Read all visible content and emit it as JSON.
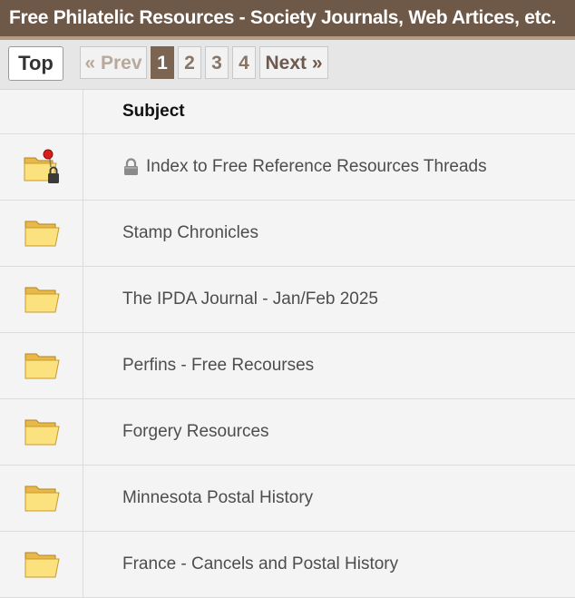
{
  "header": {
    "title": "Free Philatelic Resources - Society Journals, Web Artices, etc."
  },
  "pager": {
    "top_label": "Top",
    "prev_label": "« Prev",
    "pages": [
      "1",
      "2",
      "3",
      "4"
    ],
    "current_page": "1",
    "next_label": "Next »"
  },
  "table": {
    "header_subject": "Subject",
    "rows": [
      {
        "subject": "Index to Free Reference Resources Threads",
        "icon": "folder-pinned-locked-icon",
        "locked": true
      },
      {
        "subject": "Stamp Chronicles",
        "icon": "folder-icon"
      },
      {
        "subject": "The IPDA Journal - Jan/Feb 2025",
        "icon": "folder-icon"
      },
      {
        "subject": "Perfins - Free Recourses",
        "icon": "folder-icon"
      },
      {
        "subject": "Forgery Resources",
        "icon": "folder-icon"
      },
      {
        "subject": "Minnesota Postal History",
        "icon": "folder-icon"
      },
      {
        "subject": "France - Cancels and Postal History",
        "icon": "folder-icon"
      }
    ]
  },
  "colors": {
    "header_bg": "#6e5848",
    "accent_border": "#b59c83",
    "current_page_bg": "#7b6452"
  }
}
